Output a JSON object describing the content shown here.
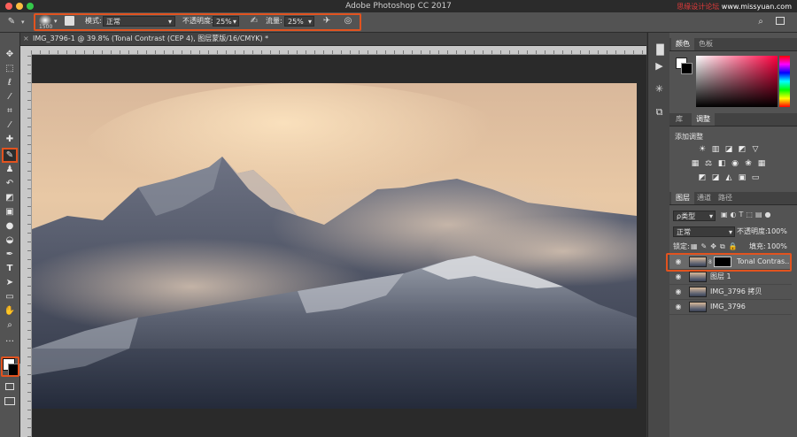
{
  "app": {
    "title": "Adobe Photoshop CC 2017",
    "watermark_prefix": "思缘设计论坛",
    "watermark_site": "www.missyuan.com"
  },
  "options_bar": {
    "brush_size": "1500",
    "mode_label": "模式:",
    "mode_value": "正常",
    "opacity_label": "不透明度:",
    "opacity_value": "25%",
    "flow_label": "流量:",
    "flow_value": "25%",
    "highlight_color": "#e2531f"
  },
  "document": {
    "tab_title": "IMG_3796-1 @ 39.8% (Tonal Contrast (CEP 4), 图层蒙版/16/CMYK) *"
  },
  "color_panel": {
    "tabs": [
      "颜色",
      "色板"
    ]
  },
  "adjustments_panel": {
    "tabs": [
      "库",
      "调整"
    ],
    "add_label": "添加调整"
  },
  "layers_panel": {
    "tabs": [
      "图层",
      "通道",
      "路径"
    ],
    "filter_value": "ρ类型",
    "blend_mode": "正常",
    "opacity_label": "不透明度:",
    "opacity_value": "100%",
    "lock_label": "锁定:",
    "fill_label": "填充:",
    "fill_value": "100%",
    "layers": [
      {
        "name": "Tonal Contras...",
        "has_mask": true,
        "selected": true
      },
      {
        "name": "图层 1",
        "has_mask": false,
        "selected": false
      },
      {
        "name": "IMG_3796 拷贝",
        "has_mask": false,
        "selected": false
      },
      {
        "name": "IMG_3796",
        "has_mask": false,
        "selected": false
      }
    ]
  },
  "toolbar": {
    "tools": [
      "move-icon",
      "marquee-icon",
      "lasso-icon",
      "quick-select-icon",
      "crop-icon",
      "eyedropper-icon",
      "healing-icon",
      "brush-icon",
      "stamp-icon",
      "history-brush-icon",
      "eraser-icon",
      "gradient-icon",
      "blur-icon",
      "dodge-icon",
      "pen-icon",
      "type-icon",
      "path-select-icon",
      "rectangle-icon",
      "hand-icon",
      "zoom-icon"
    ],
    "active_tool": "brush-icon"
  }
}
